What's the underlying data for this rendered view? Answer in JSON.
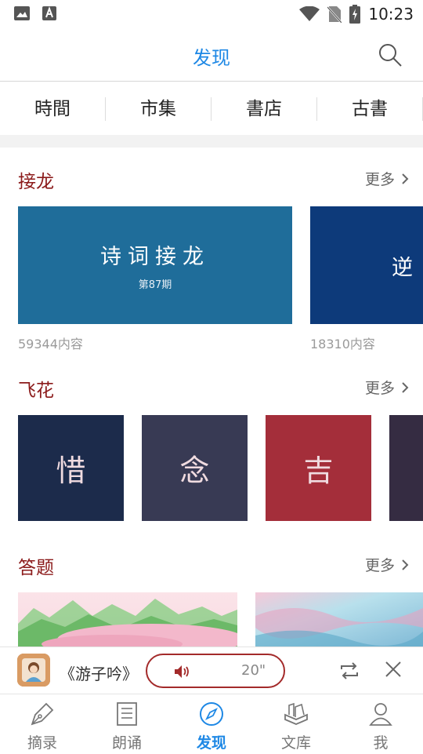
{
  "status": {
    "time": "10:23",
    "icons": [
      "image-icon",
      "font-icon",
      "wifi-icon",
      "no-sim-icon",
      "battery-icon"
    ]
  },
  "header": {
    "title": "发现"
  },
  "categories": [
    "時間",
    "市集",
    "書店",
    "古書"
  ],
  "sections": {
    "jielong": {
      "title": "接龙",
      "more": "更多",
      "cards": [
        {
          "title": "诗词接龙",
          "sub": "第87期",
          "count": "59344内容",
          "color": "#1f6d9a"
        },
        {
          "title": "逆",
          "sub": "",
          "count": "18310内容",
          "color": "#0d3a7a"
        }
      ]
    },
    "feihua": {
      "title": "飞花",
      "more": "更多",
      "tiles": [
        {
          "char": "惜",
          "color": "#1c2b4b"
        },
        {
          "char": "念",
          "color": "#383a54"
        },
        {
          "char": "吉",
          "color": "#a42e3a"
        },
        {
          "char": "",
          "color": "#352c42"
        }
      ]
    },
    "dati": {
      "title": "答题",
      "more": "更多"
    }
  },
  "player": {
    "title": "《游子吟》",
    "duration": "20\""
  },
  "tabs": [
    {
      "label": "摘录",
      "icon": "pen-icon"
    },
    {
      "label": "朗诵",
      "icon": "document-icon"
    },
    {
      "label": "发现",
      "icon": "compass-icon",
      "active": true
    },
    {
      "label": "文库",
      "icon": "books-icon"
    },
    {
      "label": "我",
      "icon": "user-icon"
    }
  ],
  "colors": {
    "accent": "#1e88e5",
    "section_title": "#8b1a1a",
    "pill_border": "#a32a2a"
  }
}
